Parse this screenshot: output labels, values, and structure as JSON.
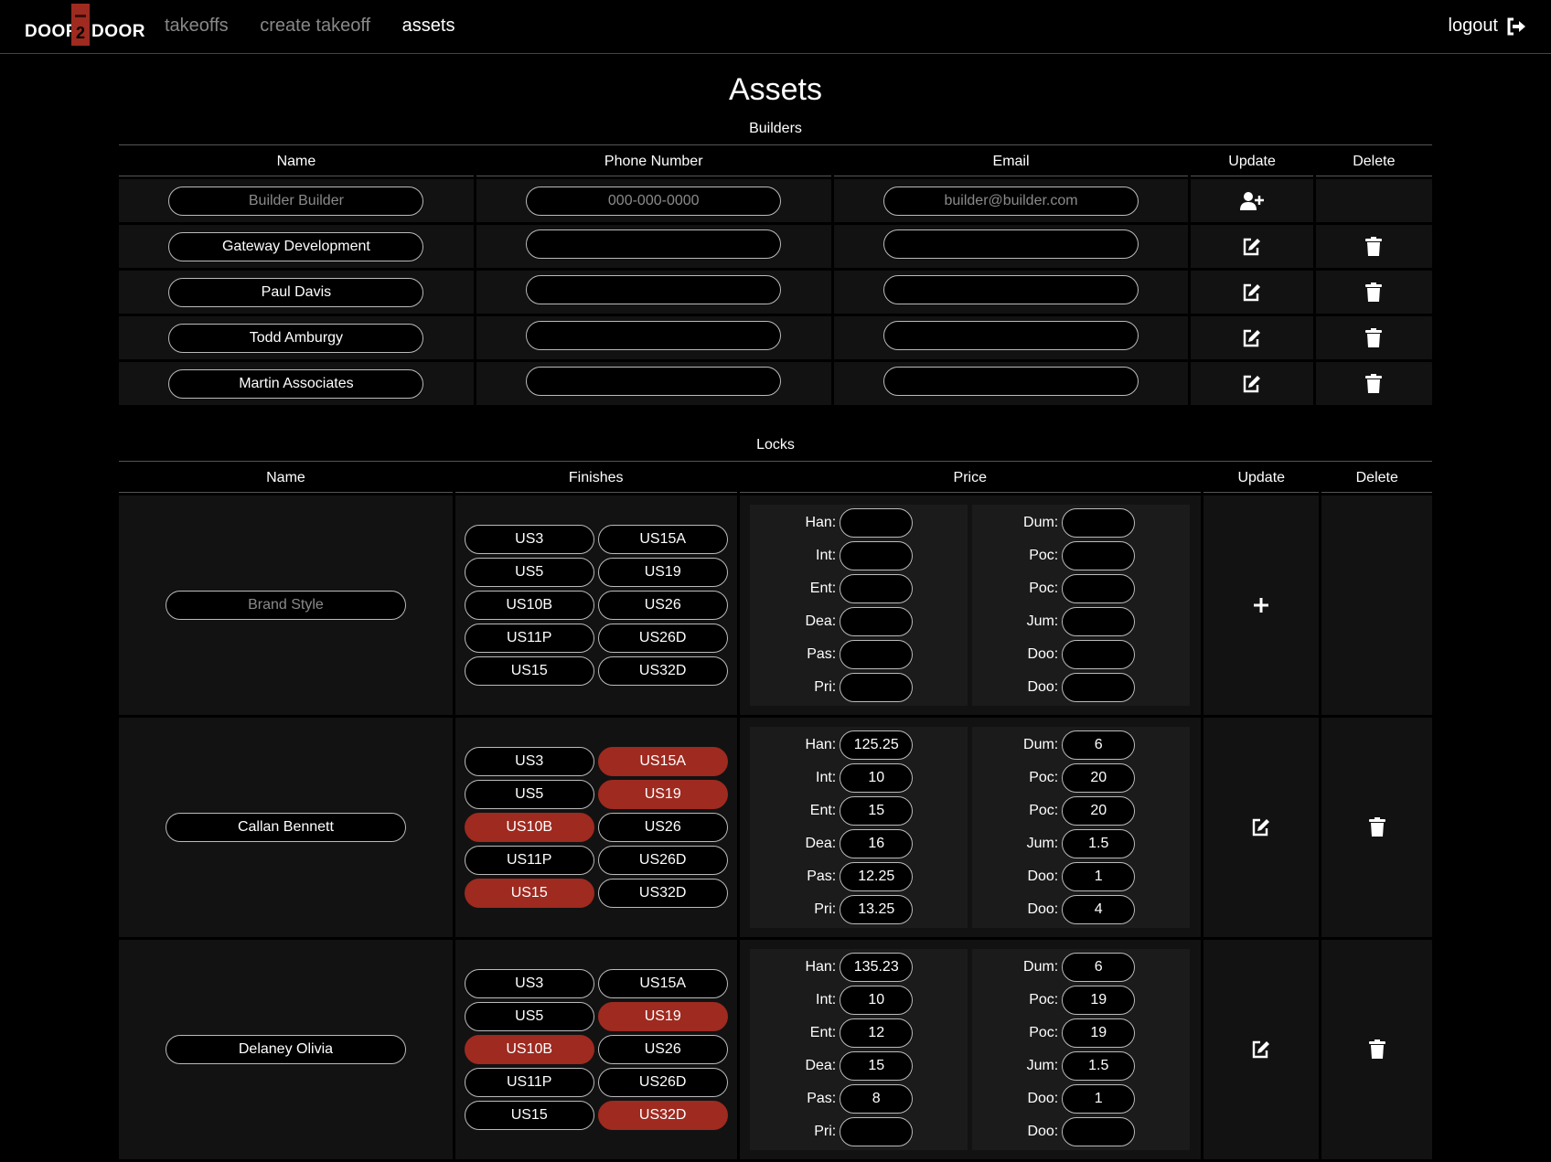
{
  "nav": {
    "logo": {
      "left": "DOOR",
      "num": "2",
      "right": "DOOR"
    },
    "links": [
      "takeoffs",
      "create takeoff",
      "assets"
    ],
    "active": "assets",
    "logout": "logout",
    "logout_icon": "sign-out-icon"
  },
  "page": {
    "title": "Assets"
  },
  "builders": {
    "title": "Builders",
    "headers": [
      "Name",
      "Phone Number",
      "Email",
      "Update",
      "Delete"
    ],
    "new_row": {
      "name_placeholder": "Builder Builder",
      "phone_placeholder": "000-000-0000",
      "email_placeholder": "builder@builder.com",
      "add_icon": "user-plus-icon"
    },
    "rows": [
      {
        "name": "Gateway Development",
        "phone": "",
        "email": ""
      },
      {
        "name": "Paul Davis",
        "phone": "",
        "email": ""
      },
      {
        "name": "Todd Amburgy",
        "phone": "",
        "email": ""
      },
      {
        "name": "Martin Associates",
        "phone": "",
        "email": ""
      }
    ]
  },
  "locks": {
    "title": "Locks",
    "headers": [
      "Name",
      "Finishes",
      "Price",
      "Update",
      "Delete"
    ],
    "finishes": [
      "US3",
      "US15A",
      "US5",
      "US19",
      "US10B",
      "US26",
      "US11P",
      "US26D",
      "US15",
      "US32D"
    ],
    "price_labels_left": [
      "Han:",
      "Int:",
      "Ent:",
      "Dea:",
      "Pas:",
      "Pri:"
    ],
    "price_labels_right": [
      "Dum:",
      "Poc:",
      "Poc:",
      "Jum:",
      "Doo:",
      "Doo:"
    ],
    "new_row": {
      "name_placeholder": "Brand Style",
      "add_icon": "plus-icon"
    },
    "rows": [
      {
        "name": "Callan Bennett",
        "selected": [
          "US15A",
          "US19",
          "US10B",
          "US15"
        ],
        "left": [
          "125.25",
          "10",
          "15",
          "16",
          "12.25",
          "13.25"
        ],
        "right": [
          "6",
          "20",
          "20",
          "1.5",
          "1",
          "4"
        ]
      },
      {
        "name": "Delaney Olivia",
        "selected": [
          "US19",
          "US10B",
          "US32D"
        ],
        "left": [
          "135.23",
          "10",
          "12",
          "15",
          "8",
          ""
        ],
        "right": [
          "6",
          "19",
          "19",
          "1.5",
          "1",
          ""
        ]
      }
    ]
  },
  "colors": {
    "background": "#000000",
    "accent": "#9e2a20",
    "cell": "#121212"
  }
}
